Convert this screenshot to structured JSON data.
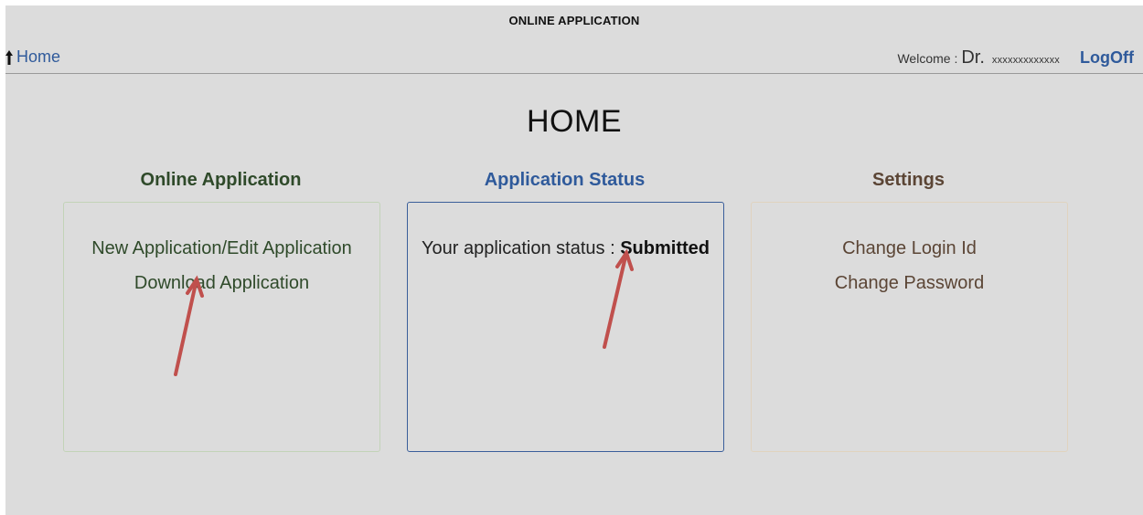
{
  "header": {
    "title": "ONLINE APPLICATION",
    "home_link": "Home",
    "welcome_label": "Welcome :",
    "user_prefix": "Dr.",
    "user_name": "xxxxxxxxxxxxx",
    "logoff_label": "LogOff"
  },
  "page": {
    "title": "HOME"
  },
  "sections": {
    "online_application": {
      "title": "Online Application",
      "links": [
        "New Application/Edit Application",
        "Download Application"
      ]
    },
    "application_status": {
      "title": "Application Status",
      "status_label": "Your application status :",
      "status_value": "Submitted"
    },
    "settings": {
      "title": "Settings",
      "links": [
        "Change Login Id",
        "Change Password"
      ]
    }
  },
  "colors": {
    "background": "#dcdcdc",
    "link_blue": "#2f5a9b",
    "online_title": "#2f4a2a",
    "status_title": "#2f5a9b",
    "settings_title": "#5b4535",
    "annotation_arrow": "#c0504d"
  },
  "icons": [
    "home-icon"
  ]
}
